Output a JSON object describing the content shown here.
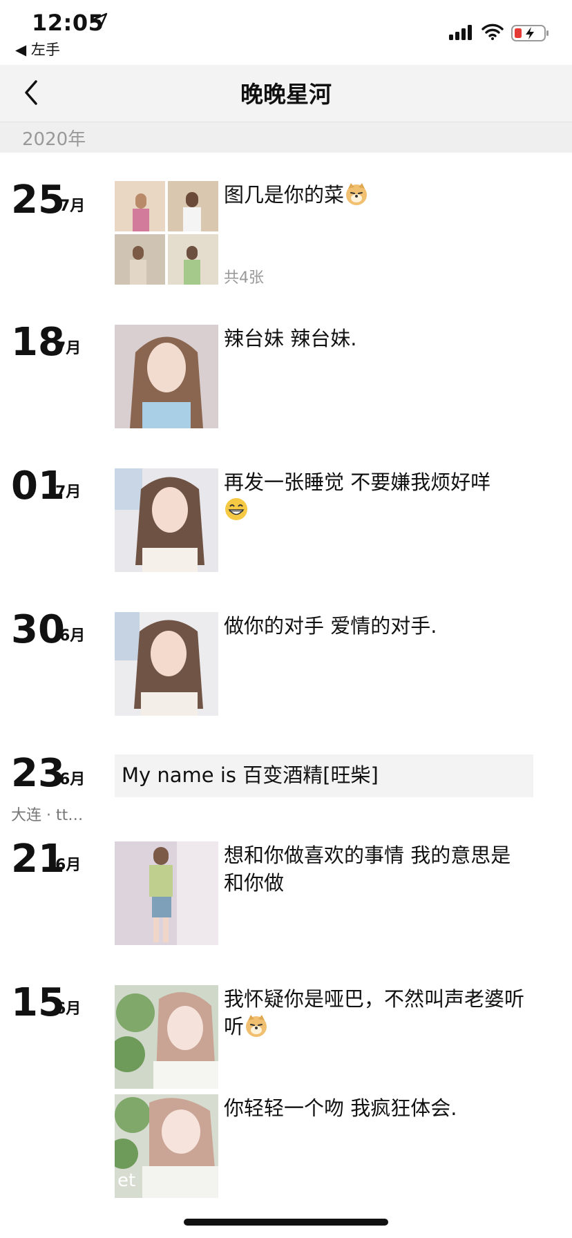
{
  "status": {
    "time": "12:05",
    "back_app": "◀ 左手"
  },
  "nav": {
    "title": "晚晚星河"
  },
  "year": "2020年",
  "posts": [
    {
      "day": "25",
      "month": "7月",
      "text": "图几是你的菜",
      "emoji": "doge-face",
      "photo_count": "共4张"
    },
    {
      "day": "18",
      "month": "7月",
      "text": "辣台妹 辣台妹."
    },
    {
      "day": "01",
      "month": "7月",
      "text": "再发一张睡觉 不要嫌我烦好咩",
      "emoji": "grin-face"
    },
    {
      "day": "30",
      "month": "6月",
      "text": "做你的对手 爱情的对手."
    },
    {
      "day": "23",
      "month": "6月",
      "text": "My name is 百变酒精[旺柴]",
      "location": "大连 · tt…"
    },
    {
      "day": "21",
      "month": "6月",
      "text": "想和你做喜欢的事情 我的意思是 和你做"
    },
    {
      "day": "15",
      "month": "6月",
      "text": "我怀疑你是哑巴，不然叫声老婆听听",
      "emoji": "doge-face",
      "text2": "你轻轻一个吻 我疯狂体会.",
      "thumb_caption": "et"
    }
  ],
  "colors": {
    "accent_text": "#111111",
    "muted": "#999999",
    "nav_bg": "#f3f3f3"
  }
}
